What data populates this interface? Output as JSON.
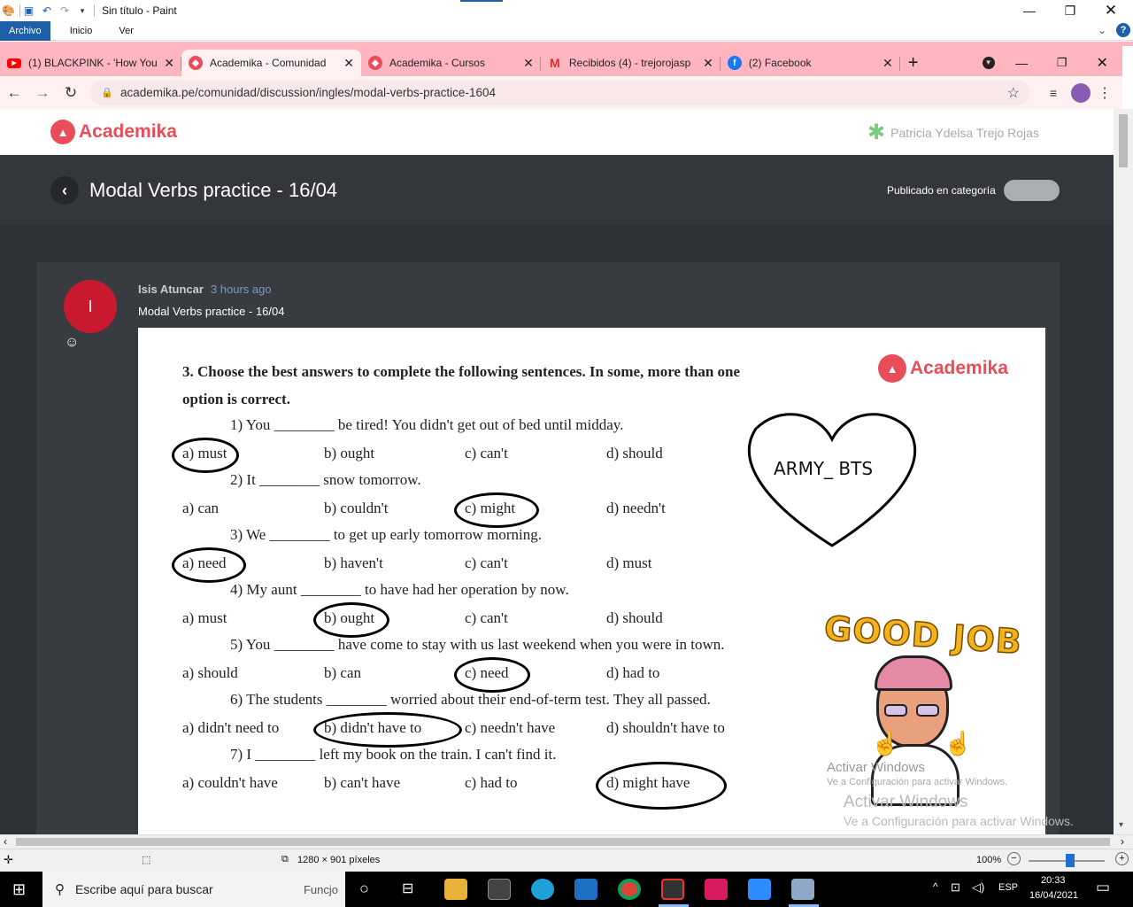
{
  "paint": {
    "title": "Sin título - Paint",
    "ribbon": {
      "file": "Archivo",
      "tabs": [
        "Inicio",
        "Ver"
      ]
    }
  },
  "browser": {
    "tabs": [
      {
        "title": "(1) BLACKPINK - 'How You",
        "favicon_color": "#ff0000",
        "favicon": "youtube-icon"
      },
      {
        "title": "Academika - Comunidad",
        "favicon_color": "#ea4d5a",
        "favicon": "academika-icon"
      },
      {
        "title": "Academika - Cursos",
        "favicon_color": "#ea4d5a",
        "favicon": "academika-icon"
      },
      {
        "title": "Recibidos (4) - trejorojasp",
        "favicon_color": "#d93025",
        "favicon": "gmail-icon"
      },
      {
        "title": "(2) Facebook",
        "favicon_color": "#1877f2",
        "favicon": "facebook-icon"
      }
    ],
    "url": "academika.pe/comunidad/discussion/ingles/modal-verbs-practice-1604"
  },
  "site": {
    "logo": "Academika",
    "user_name": "Patricia Ydelsa Trejo Rojas",
    "page_title": "Modal Verbs practice - 16/04",
    "category_label": "Publicado en categoría",
    "post": {
      "avatar_letter": "I",
      "author": "Isis Atuncar",
      "time": "3 hours ago",
      "title": "Modal Verbs practice - 16/04"
    }
  },
  "worksheet": {
    "heading_1": "3. Choose the best answers to complete the following sentences. In some, more than one",
    "heading_2": "option is correct.",
    "logo": "Academika",
    "questions": [
      {
        "sentence": "1) You ________ be tired! You didn't get out of bed until midday.",
        "options": [
          "a) must",
          "b) ought",
          "c) can't",
          "d) should"
        ],
        "circled": 0
      },
      {
        "sentence": "2) It ________ snow tomorrow.",
        "options": [
          "a) can",
          "b) couldn't",
          "c) might",
          "d) needn't"
        ],
        "circled": 2
      },
      {
        "sentence": "3) We ________ to get up early tomorrow morning.",
        "options": [
          "a) need",
          "b) haven't",
          "c) can't",
          "d) must"
        ],
        "circled": 0
      },
      {
        "sentence": "4) My aunt ________ to have had her operation by now.",
        "options": [
          "a) must",
          "b) ought",
          "c) can't",
          "d) should"
        ],
        "circled": 1
      },
      {
        "sentence": "5) You ________ have come to stay with us last weekend when you were in town.",
        "options": [
          "a) should",
          "b) can",
          "c) need",
          "d) had to"
        ],
        "circled": 2
      },
      {
        "sentence": "6) The students ________ worried about their end-of-term test. They all passed.",
        "options": [
          "a) didn't need to",
          "b) didn't have to",
          "c) needn't have",
          "d) shouldn't have to"
        ],
        "circled": 1
      },
      {
        "sentence": "7) I ________ left my book on the train. I can't find it.",
        "options": [
          "a) couldn't have",
          "b) can't have",
          "c) had to",
          "d) might have"
        ],
        "circled": 3
      }
    ],
    "heart_text": "ARMY_ BTS",
    "sticker_text": "GOOD JOB",
    "watermark_small_1": "Activar Windows",
    "watermark_small_2": "Ve a Configuración para activar Windows."
  },
  "windows_watermark": {
    "line1": "Activar Windows",
    "line2": "Ve a Configuración para activar Windows."
  },
  "statusbar": {
    "size": "1280 × 901 píxeles",
    "zoom": "100%",
    "zoom_fraction": 0.5
  },
  "taskbar": {
    "search_placeholder": "Escribe aquí para buscar",
    "lang": "ESP",
    "time": "20:33",
    "date": "16/04/2021",
    "bg_text": "Funcjo"
  }
}
